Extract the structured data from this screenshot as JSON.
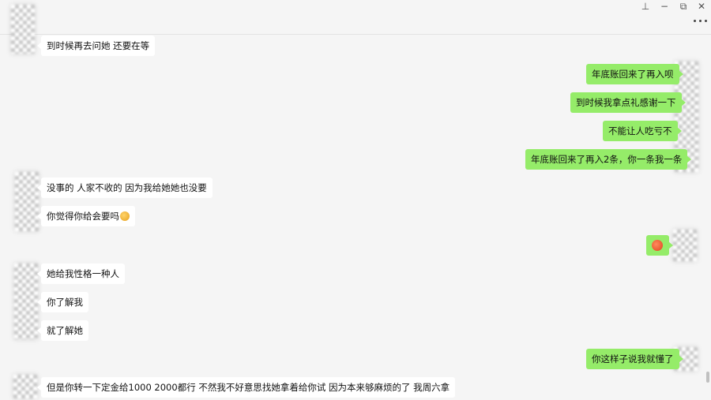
{
  "window": {
    "controls": {
      "pin_glyph": "⊥",
      "minimize_glyph": "−",
      "restore_glyph": "⧉",
      "close_glyph": "✕"
    }
  },
  "messages": [
    {
      "side": "left",
      "text": "到时候再去问她  还要在等"
    },
    {
      "side": "right",
      "text": "年底账回来了再入呗"
    },
    {
      "side": "right",
      "text": "到时候我拿点礼感谢一下"
    },
    {
      "side": "right",
      "text": "不能让人吃亏不"
    },
    {
      "side": "right",
      "text": "年底账回来了再入2条，你一条我一条"
    },
    {
      "side": "left",
      "text": "没事的 人家不收的 因为我给她她也没要"
    },
    {
      "side": "left",
      "text": "你觉得你给会要吗",
      "emoji": "grimace-emoji"
    },
    {
      "side": "right",
      "text": "",
      "emoji": "angry-face-emoji"
    },
    {
      "side": "left",
      "text": "她给我性格一种人"
    },
    {
      "side": "left",
      "text": "你了解我"
    },
    {
      "side": "left",
      "text": "就了解她"
    },
    {
      "side": "right",
      "text": "你这样子说我就懂了"
    },
    {
      "side": "left",
      "text": "但是你转一下定金给1000 2000都行 不然我不好意思找她拿着给你试 因为本来够麻烦的了  我周六拿"
    }
  ],
  "colors": {
    "background": "#f5f5f5",
    "bubble_self": "#95ec69",
    "bubble_other": "#ffffff"
  }
}
